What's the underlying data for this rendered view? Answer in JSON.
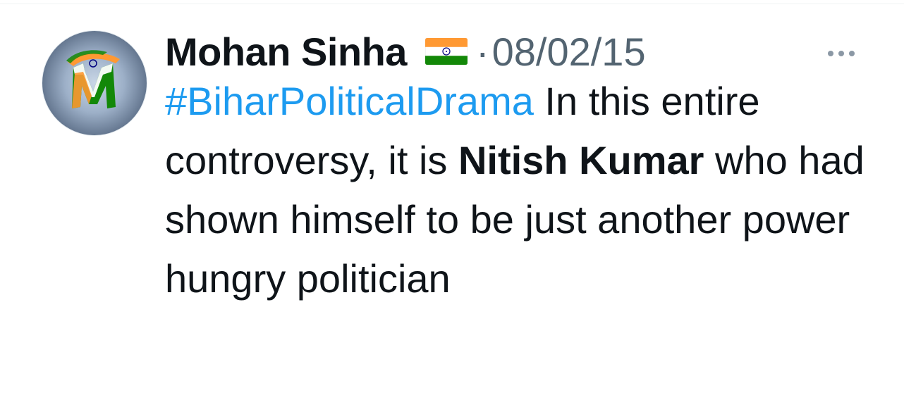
{
  "tweet": {
    "display_name": "Mohan Sinha",
    "flag_icon": "india-flag-icon",
    "separator": "·",
    "date": "08/02/15",
    "more_icon": "more-horizontal-icon",
    "text": {
      "hashtag": "#BiharPoliticalDrama",
      "part1": " In this entire controversy, it is ",
      "bold": "Nitish Kumar",
      "part2": " who had shown himself to be just another power hungry politician"
    }
  },
  "avatar": {
    "letter": "M"
  },
  "colors": {
    "link": "#1d9bf0",
    "secondary_text": "#536471",
    "primary_text": "#0f1419",
    "saffron": "#ff9933",
    "green": "#138808",
    "navy": "#000080"
  }
}
